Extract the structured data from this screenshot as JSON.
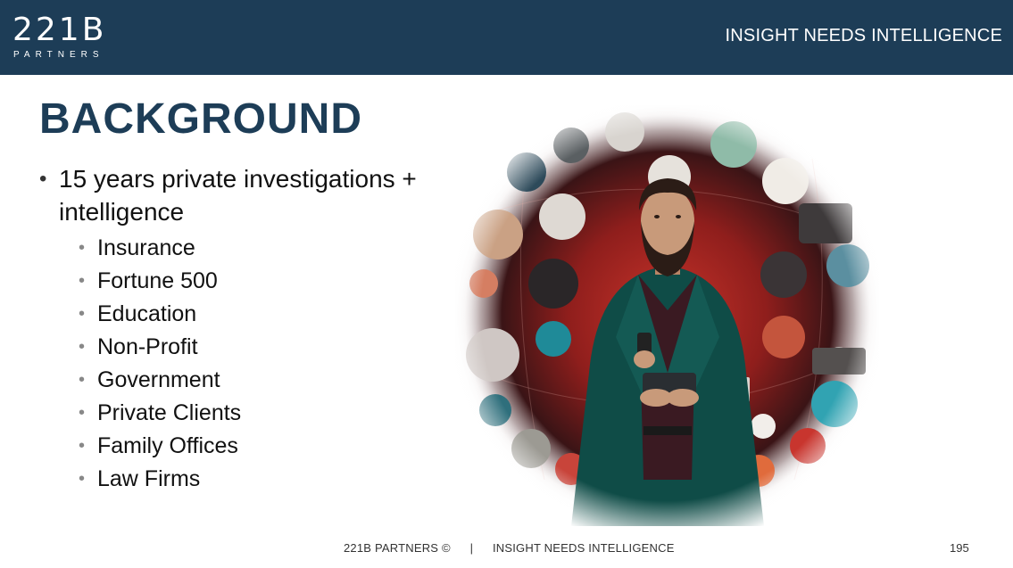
{
  "header": {
    "logo_mark": "221B",
    "logo_sub": "PARTNERS",
    "tagline": "INSIGHT NEEDS INTELLIGENCE"
  },
  "slide": {
    "title": "BACKGROUND",
    "main_bullet": "15 years private investigations + intelligence",
    "sub_bullets": [
      "Insurance",
      "Fortune 500",
      "Education",
      "Non-Profit",
      "Government",
      "Private Clients",
      "Family Offices",
      "Law Firms"
    ]
  },
  "footer": {
    "left": "221B PARTNERS ©",
    "separator": "|",
    "right": "INSIGHT NEEDS INTELLIGENCE",
    "page_number": "195"
  },
  "colors": {
    "header_bg": "#1d3d57",
    "title": "#1d3d57",
    "illustration_bg": "#a8231f"
  }
}
